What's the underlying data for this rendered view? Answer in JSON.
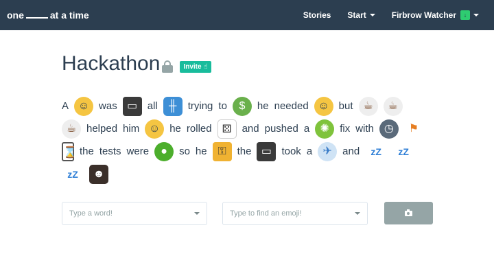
{
  "nav": {
    "brand_before": "one",
    "brand_after": "at a time",
    "stories_label": "Stories",
    "start_label": "Start",
    "user_label": "Firbrow Watcher",
    "user_icon": "download-icon"
  },
  "page": {
    "title": "Hackathon",
    "invite_label": "Invite",
    "lock_icon": "lock-icon",
    "invite_icon": "pointing-hand-icon"
  },
  "story": {
    "tokens": [
      {
        "type": "word",
        "text": "A"
      },
      {
        "type": "emoji",
        "name": "person-face-emoji",
        "glyph": "☺",
        "cls": "face"
      },
      {
        "type": "word",
        "text": "was"
      },
      {
        "type": "emoji",
        "name": "desktop-computer-emoji",
        "glyph": "▭",
        "cls": "monitor"
      },
      {
        "type": "word",
        "text": "all"
      },
      {
        "type": "emoji",
        "name": "bridge-at-night-emoji",
        "glyph": "╫",
        "cls": "bridge"
      },
      {
        "type": "word",
        "text": "trying"
      },
      {
        "type": "word",
        "text": "to"
      },
      {
        "type": "emoji",
        "name": "money-with-wings-emoji",
        "glyph": "$",
        "cls": "money"
      },
      {
        "type": "word",
        "text": "he"
      },
      {
        "type": "word",
        "text": "needed"
      },
      {
        "type": "emoji",
        "name": "sleeping-face-emoji",
        "glyph": "☺",
        "cls": "face"
      },
      {
        "type": "word",
        "text": "but"
      },
      {
        "type": "emoji",
        "name": "hot-beverage-emoji",
        "glyph": "☕",
        "cls": "coffee"
      },
      {
        "type": "emoji",
        "name": "hot-beverage-emoji",
        "glyph": "☕",
        "cls": "coffee"
      },
      {
        "type": "emoji",
        "name": "hot-beverage-emoji",
        "glyph": "☕",
        "cls": "coffee"
      },
      {
        "type": "word",
        "text": "helped"
      },
      {
        "type": "word",
        "text": "him"
      },
      {
        "type": "emoji",
        "name": "grinning-face-emoji",
        "glyph": "☺",
        "cls": "face"
      },
      {
        "type": "word",
        "text": "he"
      },
      {
        "type": "word",
        "text": "rolled"
      },
      {
        "type": "emoji",
        "name": "game-die-emoji",
        "glyph": "⚄",
        "cls": "dice"
      },
      {
        "type": "word",
        "text": "and"
      },
      {
        "type": "word",
        "text": "pushed"
      },
      {
        "type": "word",
        "text": "a"
      },
      {
        "type": "emoji",
        "name": "bug-emoji",
        "glyph": "✺",
        "cls": "bug"
      },
      {
        "type": "word",
        "text": "fix"
      },
      {
        "type": "word",
        "text": "with"
      },
      {
        "type": "emoji",
        "name": "clock-emoji",
        "glyph": "◷",
        "cls": "clock"
      },
      {
        "type": "emoji",
        "name": "runner-emoji",
        "glyph": "⚑",
        "cls": "runner"
      },
      {
        "type": "emoji",
        "name": "hourglass-emoji",
        "glyph": "⌛",
        "cls": "hourglass"
      },
      {
        "type": "word",
        "text": "the"
      },
      {
        "type": "word",
        "text": "tests"
      },
      {
        "type": "word",
        "text": "were"
      },
      {
        "type": "emoji",
        "name": "green-apple-emoji",
        "glyph": "●",
        "cls": "apple"
      },
      {
        "type": "word",
        "text": "so"
      },
      {
        "type": "word",
        "text": "he"
      },
      {
        "type": "emoji",
        "name": "closed-lock-with-key-emoji",
        "glyph": "⚿",
        "cls": "lockkey"
      },
      {
        "type": "word",
        "text": "the"
      },
      {
        "type": "emoji",
        "name": "desktop-computer-emoji",
        "glyph": "▭",
        "cls": "monitor"
      },
      {
        "type": "word",
        "text": "took"
      },
      {
        "type": "word",
        "text": "a"
      },
      {
        "type": "emoji",
        "name": "satellite-emoji",
        "glyph": "✈",
        "cls": "satellite"
      },
      {
        "type": "word",
        "text": "and"
      },
      {
        "type": "emoji",
        "name": "zzz-emoji",
        "glyph": "zZ",
        "cls": "zzz"
      },
      {
        "type": "emoji",
        "name": "zzz-emoji",
        "glyph": "zZ",
        "cls": "zzz"
      },
      {
        "type": "emoji",
        "name": "zzz-emoji",
        "glyph": "zZ",
        "cls": "zzz"
      },
      {
        "type": "emoji",
        "name": "user-photo-emoji",
        "glyph": "☻",
        "cls": "photo"
      }
    ]
  },
  "form": {
    "word_placeholder": "Type a word!",
    "emoji_placeholder": "Type to find an emoji!",
    "camera_icon": "camera-icon"
  },
  "colors": {
    "navbar": "#2c3e50",
    "accent": "#18bc9c",
    "muted": "#95a5a6"
  }
}
